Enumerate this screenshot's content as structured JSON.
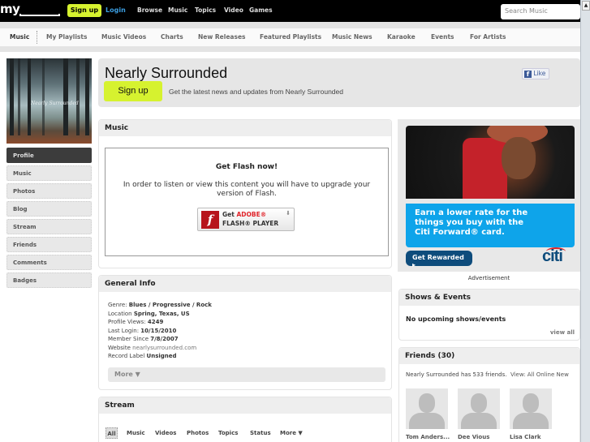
{
  "topbar": {
    "logo": "my",
    "signup": "Sign up",
    "login": "Login",
    "nav": [
      "Browse",
      "Music",
      "Topics",
      "Video",
      "Games"
    ],
    "search_placeholder": "Search Music"
  },
  "subnav": {
    "items": [
      "Music",
      "My Playlists",
      "Music Videos",
      "Charts",
      "New Releases",
      "Featured Playlists",
      "Music News",
      "Karaoke",
      "Events",
      "For Artists"
    ],
    "active": "Music"
  },
  "album": {
    "caption": "Nearly Surrounded"
  },
  "sidebar": {
    "items": [
      {
        "label": "Profile",
        "active": true
      },
      {
        "label": "Music"
      },
      {
        "label": "Photos"
      },
      {
        "label": "Blog"
      },
      {
        "label": "Stream"
      },
      {
        "label": "Friends"
      },
      {
        "label": "Comments"
      },
      {
        "label": "Badges"
      }
    ]
  },
  "header": {
    "title": "Nearly Surrounded",
    "signup": "Sign up",
    "subtitle": "Get the latest news and updates from Nearly Surrounded",
    "fb_like": "Like"
  },
  "music": {
    "title": "Music",
    "flash_title": "Get Flash now!",
    "flash_message": "In order to listen or view this content you will have to upgrade your version of Flash.",
    "flash_btn_get": "Get",
    "flash_btn_adobe": "ADOBE®",
    "flash_btn_player": "FLASH® PLAYER"
  },
  "general_info": {
    "title": "General Info",
    "genre_label": "Genre:",
    "genre": "Blues / Progressive / Rock",
    "location_label": "Location",
    "location": "Spring, Texas, US",
    "views_label": "Profile Views:",
    "views": "4249",
    "login_label": "Last Login:",
    "login": "10/15/2010",
    "since_label": "Member Since",
    "since": "7/8/2007",
    "website_label": "Website",
    "website": "nearlysurrounded.com",
    "label_label": "Record Label",
    "label": "Unsigned",
    "more": "More ▼"
  },
  "stream": {
    "title": "Stream",
    "tabs": [
      "All",
      "Music",
      "Videos",
      "Photos",
      "Topics",
      "Status",
      "More ▼"
    ]
  },
  "ad": {
    "headline": "Earn a lower rate for the things you buy with the Citi Forward® card.",
    "line1": "Earn a lower rate for the",
    "line2": "things you buy with the",
    "line3": "Citi Forward® card.",
    "button": "Get Rewarded ▸",
    "brand": "citi",
    "caption": "Advertisement"
  },
  "shows": {
    "title": "Shows & Events",
    "message": "No upcoming shows/events",
    "view_all": "view all"
  },
  "friends": {
    "title": "Friends (30)",
    "summary": "Nearly Surrounded has 533 friends.",
    "view_label": "View:",
    "view_options": [
      "All",
      "Online",
      "New"
    ],
    "list": [
      "Tom Anders...",
      "Dee Vious",
      "Lisa Clark"
    ]
  }
}
